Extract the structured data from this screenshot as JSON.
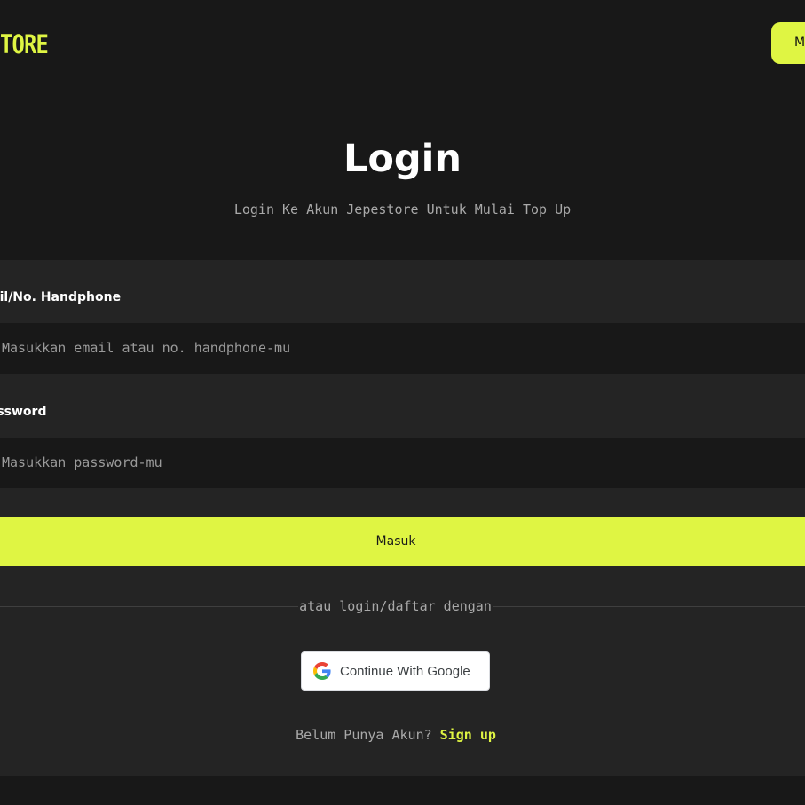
{
  "header": {
    "logo_text": "TORE",
    "button_label": "Masuk"
  },
  "main": {
    "title": "Login",
    "subtitle": "Login Ke Akun Jepestore Untuk Mulai Top Up"
  },
  "form": {
    "email_label": "Email/No. Handphone",
    "email_placeholder": "Masukkan email atau no. handphone-mu",
    "password_label": "Password",
    "password_placeholder": "Masukkan password-mu",
    "submit_label": "Masuk",
    "divider_text": "atau login/daftar dengan",
    "google_label": "Continue With Google",
    "signup_question": "Belum Punya Akun?",
    "signup_link": "Sign up"
  },
  "colors": {
    "background": "#181818",
    "card": "#242424",
    "accent": "#dff543",
    "text": "#ffffff",
    "muted": "#a9a9a9"
  },
  "icons": {
    "google": "google-g-icon"
  }
}
